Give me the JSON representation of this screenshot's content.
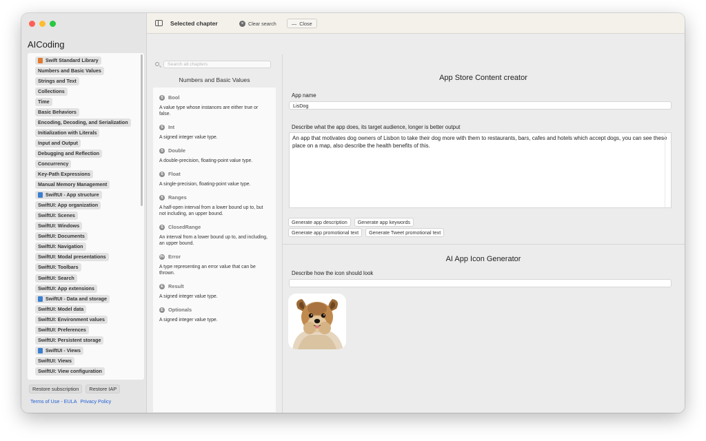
{
  "window": {
    "app_title": "AICoding"
  },
  "toolbar": {
    "title": "Selected chapter",
    "clear_search": "Clear search",
    "close": "Close"
  },
  "sidebar": {
    "chapters": [
      {
        "label": "Swift Standard Library",
        "icon": "book-orange"
      },
      {
        "label": "Numbers and Basic Values"
      },
      {
        "label": "Strings and Text"
      },
      {
        "label": "Collections"
      },
      {
        "label": "Time"
      },
      {
        "label": "Basic Behaviors"
      },
      {
        "label": "Encoding, Decoding, and Serialization"
      },
      {
        "label": "Initialization with Literals"
      },
      {
        "label": "Input and Output"
      },
      {
        "label": "Debugging and Reflection"
      },
      {
        "label": "Concurrency"
      },
      {
        "label": "Key-Path Expressions"
      },
      {
        "label": "Manual Memory Management"
      },
      {
        "label": "SwiftUI - App structure",
        "icon": "book-blue"
      },
      {
        "label": "SwiftUI: App organization"
      },
      {
        "label": "SwiftUI: Scenes"
      },
      {
        "label": "SwiftUI: Windows"
      },
      {
        "label": "SwiftUI: Documents"
      },
      {
        "label": "SwiftUI: Navigation"
      },
      {
        "label": "SwiftUI: Modal presentations"
      },
      {
        "label": "SwiftUI: Toolbars"
      },
      {
        "label": "SwiftUI: Search"
      },
      {
        "label": "SwiftUI: App extensions"
      },
      {
        "label": "SwiftUI - Data and storage",
        "icon": "book-blue"
      },
      {
        "label": "SwiftUI: Model data"
      },
      {
        "label": "SwiftUI: Environment values"
      },
      {
        "label": "SwiftUI: Preferences"
      },
      {
        "label": "SwiftUI: Persistent storage"
      },
      {
        "label": "SwiftUI - Views",
        "icon": "book-blue"
      },
      {
        "label": "SwiftUI: Views"
      },
      {
        "label": "SwiftUI: View configuration"
      }
    ],
    "restore_subscription": "Restore subscription",
    "restore_iap": "Restore IAP",
    "terms_link": "Terms of Use - EULA",
    "privacy_link": "Privacy Policy"
  },
  "middle": {
    "search_placeholder": "Search all chapters",
    "heading": "Numbers and Basic Values",
    "entries": [
      {
        "badge": "S",
        "title": "Bool",
        "desc": "A value type whose instances are either true or false."
      },
      {
        "badge": "S",
        "title": "Int",
        "desc": "A signed integer value type."
      },
      {
        "badge": "S",
        "title": "Double",
        "desc": "A double-precision, floating-point value type."
      },
      {
        "badge": "S",
        "title": "Float",
        "desc": "A single-precision, floating-point value type."
      },
      {
        "badge": "S",
        "title": "Ranges",
        "desc": "A half-open interval from a lower bound up to, but not including, an upper bound."
      },
      {
        "badge": "S",
        "title": "ClosedRange",
        "desc": "An interval from a lower bound up to, and including, an upper bound."
      },
      {
        "badge": "Pr",
        "title": "Error",
        "desc": "A type representing an error value that can be thrown."
      },
      {
        "badge": "E",
        "title": "Result",
        "desc": "A signed integer value type."
      },
      {
        "badge": "E",
        "title": "Optionals",
        "desc": "A signed integer value type."
      }
    ]
  },
  "right": {
    "content_title": "App Store Content creator",
    "app_name_label": "App name",
    "app_name_value": "LisDog",
    "describe_label": "Describe what the app does, its target audience, longer is better output",
    "describe_value": "An app that motivates dog owners of Lisbon to take their dog more with them to restaurants, bars, cafes and hotels which accept dogs, you can see these place on a map, also describe the health benefits of this.",
    "buttons_row1": [
      "Generate app description",
      "Generate app keywords"
    ],
    "buttons_row2": [
      "Generate app promotional text",
      "Generate Tweet promotional text"
    ],
    "icon_title": "AI App Icon Generator",
    "icon_label": "Describe how the icon should look",
    "icon_value": ""
  },
  "colors": {
    "link": "#1f5fd6",
    "traffic_red": "#fe5f57",
    "traffic_yellow": "#febc2e",
    "traffic_green": "#28c840",
    "book_orange": "#e07a2e",
    "book_blue": "#3c7fd0"
  }
}
